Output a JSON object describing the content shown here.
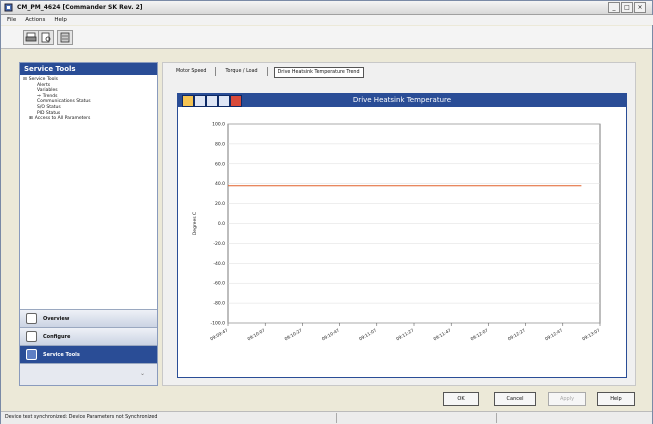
{
  "window": {
    "title": "CM_PM_4624 [Commander SK Rev. 2]"
  },
  "menu": {
    "items": [
      "File",
      "Actions",
      "Help"
    ]
  },
  "toolbar": {
    "buttons": [
      "print-icon",
      "print-preview-icon",
      "database-icon"
    ]
  },
  "left_panel": {
    "title": "Service Tools",
    "tree": [
      {
        "label": "Service Tools",
        "level": 0,
        "expander": "⊟"
      },
      {
        "label": "Alerts",
        "level": 2
      },
      {
        "label": "Variables",
        "level": 2
      },
      {
        "label": "Trends",
        "level": 2,
        "marker": "⇒"
      },
      {
        "label": "Communications Status",
        "level": 2
      },
      {
        "label": "S/O Status",
        "level": 2
      },
      {
        "label": "PID Status",
        "level": 2
      },
      {
        "label": "Access to All Parameters",
        "level": 1,
        "expander": "⊞"
      }
    ],
    "nav": [
      {
        "label": "Overview",
        "active": false
      },
      {
        "label": "Configure",
        "active": false
      },
      {
        "label": "Service Tools",
        "active": true
      }
    ]
  },
  "tabs": {
    "items": [
      "Motor Speed",
      "Torque / Load",
      "Drive Heatsink Temperature Trend"
    ],
    "selected": 2
  },
  "chart_toolbar": {
    "icons": [
      "pointer-icon",
      "grid-icon",
      "zoom-icon",
      "pan-icon",
      "clear-icon"
    ]
  },
  "chart_data": {
    "type": "line",
    "title": "Drive Heatsink Temperature",
    "ylabel": "Degrees C",
    "xlabel": "",
    "ylim": [
      -100,
      100
    ],
    "yticks": [
      100,
      80,
      60,
      40,
      20,
      0,
      -20,
      -40,
      -60,
      -80,
      -100
    ],
    "ytick_labels": [
      "100.0",
      "80.0",
      "60.0",
      "40.0",
      "20.0",
      "0.0",
      "-20.0",
      "-40.0",
      "-60.0",
      "-80.0",
      "-100.0"
    ],
    "x_ticks": [
      "09:09:47",
      "09:10:07",
      "09:10:27",
      "09:10:47",
      "09:11:07",
      "09:11:27",
      "09:11:47",
      "09:12:07",
      "09:12:27",
      "09:12:47",
      "09:13:07"
    ],
    "grid": true,
    "series": [
      {
        "color": "#e0602a",
        "x": [
          0,
          9.5
        ],
        "values": [
          38,
          38
        ]
      }
    ]
  },
  "buttons": {
    "ok": "OK",
    "cancel": "Cancel",
    "apply": "Apply",
    "help": "Help"
  },
  "status": {
    "text": "Device text synchronized: Device Parameters not Synchronized"
  },
  "colors": {
    "accent": "#2a4d96",
    "series": "#e0602a"
  }
}
